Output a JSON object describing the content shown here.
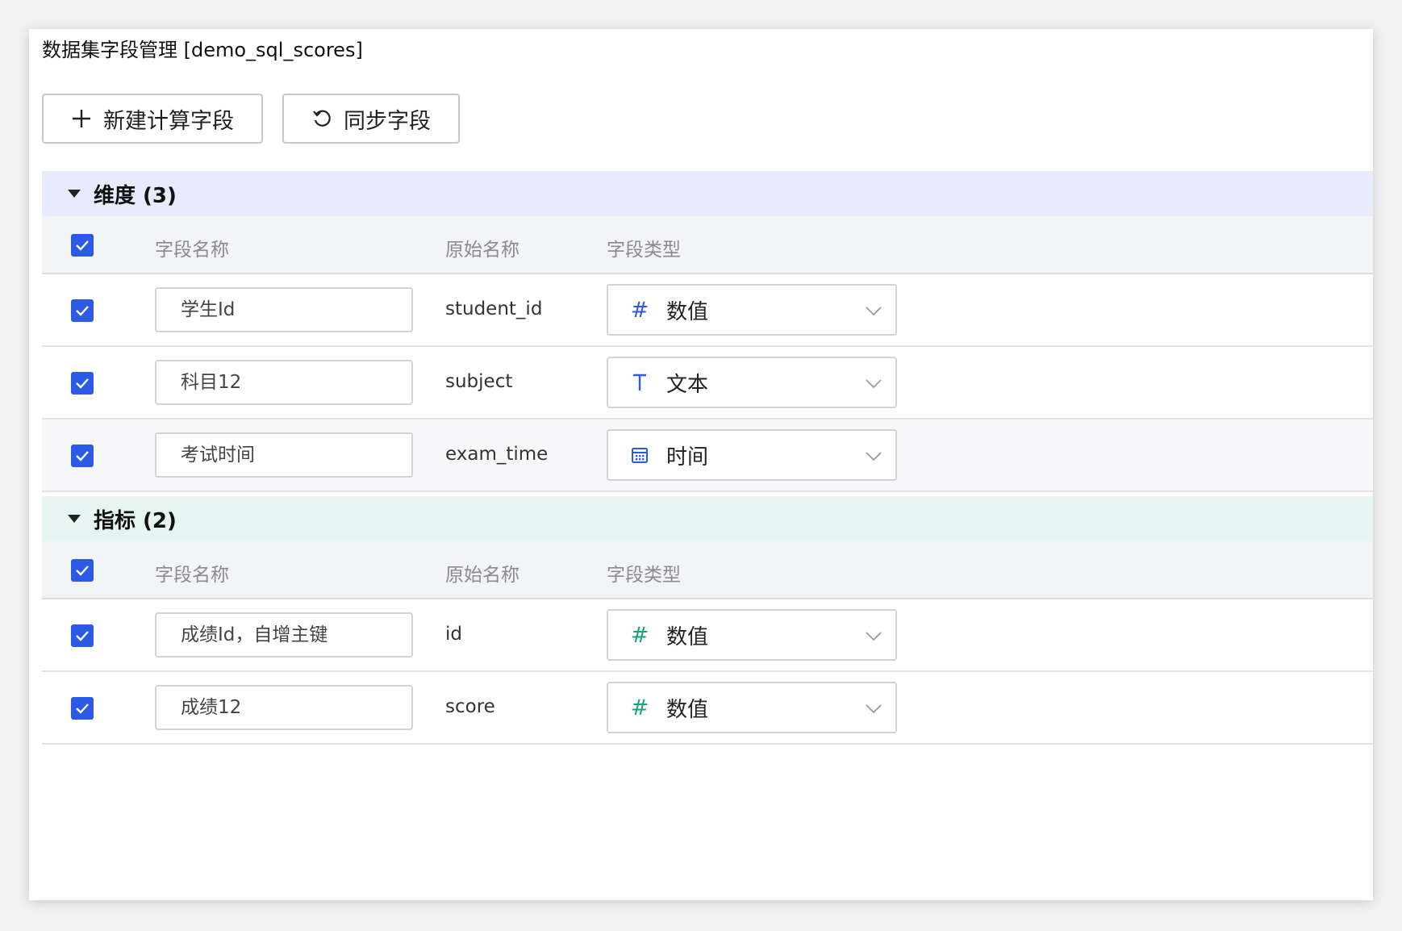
{
  "title": "数据集字段管理 [demo_sql_scores]",
  "toolbar": {
    "new_calc_label": "新建计算字段",
    "sync_label": "同步字段"
  },
  "columns": {
    "name": "字段名称",
    "original": "原始名称",
    "type": "字段类型"
  },
  "dimensions": {
    "label": "维度 (3)",
    "accent": "#2b5be6",
    "rows": [
      {
        "name": "学生Id",
        "original": "student_id",
        "type": "数值",
        "icon": "hash-icon"
      },
      {
        "name": "科目12",
        "original": "subject",
        "type": "文本",
        "icon": "text-t-icon"
      },
      {
        "name": "考试时间",
        "original": "exam_time",
        "type": "时间",
        "icon": "calendar-icon"
      }
    ]
  },
  "metrics": {
    "label": "指标 (2)",
    "accent": "#1aa37a",
    "rows": [
      {
        "name": "成绩Id，自增主键",
        "original": "id",
        "type": "数值",
        "icon": "hash-icon"
      },
      {
        "name": "成绩12",
        "original": "score",
        "type": "数值",
        "icon": "hash-icon"
      }
    ]
  }
}
